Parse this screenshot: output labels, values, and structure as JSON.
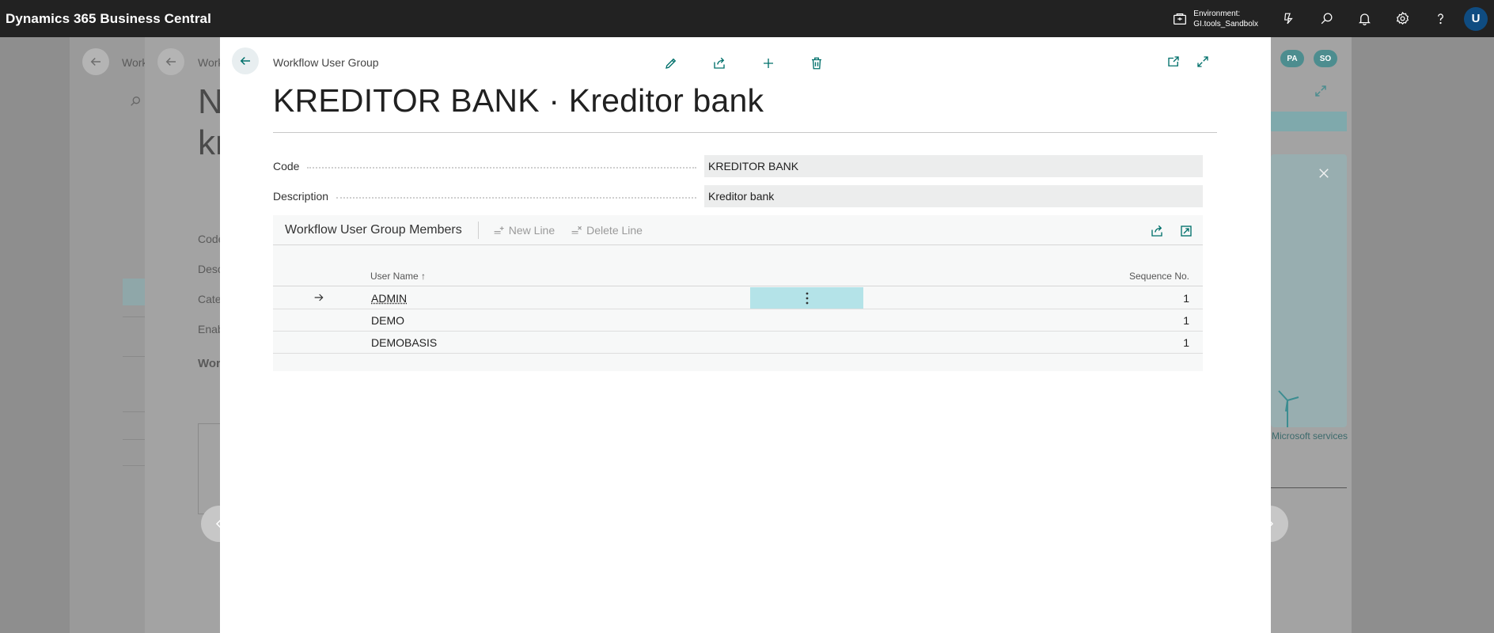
{
  "app": {
    "title": "Dynamics 365 Business Central",
    "environment_label": "Environment:",
    "environment_name": "GI.tools_Sandbolx",
    "user_initial": "U",
    "icons": [
      "environment-icon",
      "copilot-icon",
      "search-icon",
      "bell-icon",
      "gear-icon",
      "help-icon"
    ]
  },
  "background": {
    "crumb1": "Work",
    "crumb2": "Work",
    "big_title_1": "N",
    "big_title_2": "kr",
    "labels": [
      "Code",
      "Desc",
      "Cate",
      "Enab"
    ],
    "section": "Wor",
    "badges": [
      "PA",
      "SO"
    ],
    "ms_link": "Microsoft services"
  },
  "modal": {
    "breadcrumb": "Workflow User Group",
    "title": "KREDITOR BANK · Kreditor bank",
    "fields": {
      "code_label": "Code",
      "code_value": "KREDITOR BANK",
      "description_label": "Description",
      "description_value": "Kreditor bank"
    },
    "subpage": {
      "title": "Workflow User Group Members",
      "new_line": "New Line",
      "delete_line": "Delete Line",
      "columns": {
        "user_name": "User Name ↑",
        "sequence_no": "Sequence No."
      },
      "rows": [
        {
          "user": "ADMIN",
          "seq": "1"
        },
        {
          "user": "DEMO",
          "seq": "1"
        },
        {
          "user": "DEMOBASIS",
          "seq": "1"
        }
      ]
    }
  },
  "colors": {
    "topbar": "#222222",
    "accent": "#00706b",
    "selected_cell": "#b4e3e8",
    "avatar": "#0f4c81"
  }
}
